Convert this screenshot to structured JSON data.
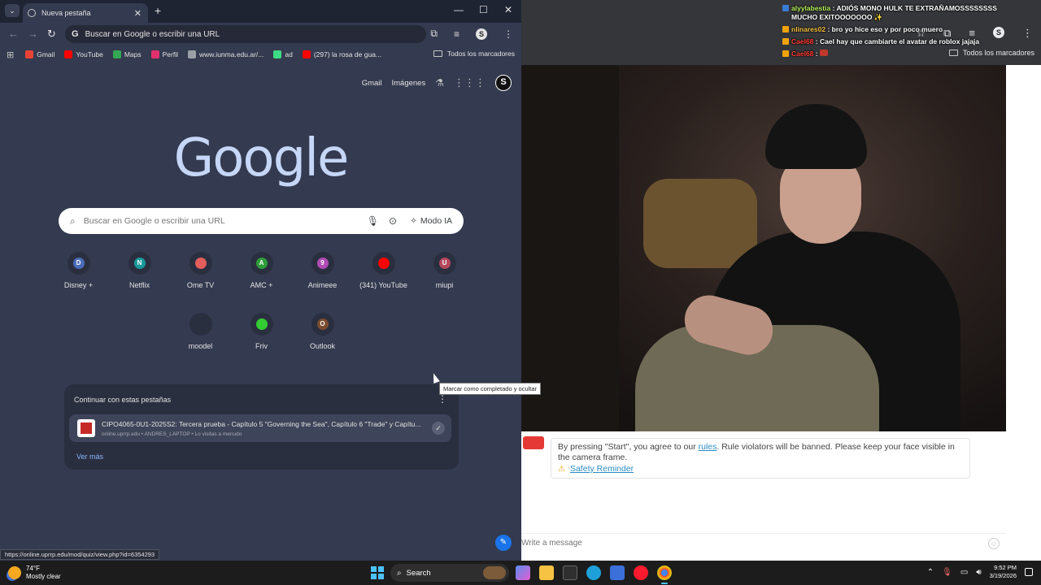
{
  "right_window": {
    "all_bookmarks": "Todos los marcadores",
    "chat": [
      {
        "user": "alyylabestia",
        "sep": ":",
        "text": "ADIÓS MONO HULK TE EXTRAÑAMOSSSSSSSS MUCHO EXITOOOOOOO ✨",
        "user_color": "green"
      },
      {
        "user": "nlinares02",
        "sep": ":",
        "text": "bro yo hice eso y por poco muero",
        "user_color": "yellow"
      },
      {
        "user": "Cael68",
        "sep": ":",
        "text": "Cael hay que cambiarte el avatar de roblox jajaja",
        "user_color": "red"
      },
      {
        "user": "Cael68",
        "sep": ":",
        "text": "",
        "user_color": "red"
      }
    ],
    "notice": {
      "before_link": "By pressing \"Start\", you agree to our ",
      "link": "rules",
      "after_link": ". Rule violators will be banned. Please keep your face visible in the camera frame.",
      "safety_link": "Safety Reminder"
    },
    "message_placeholder": "Write a message"
  },
  "chrome": {
    "tab_title": "Nueva pestaña",
    "omnibox_text": "Buscar en Google o escribir una URL",
    "bookmarks": [
      {
        "label": "Gmail",
        "color": "#ea4335"
      },
      {
        "label": "YouTube",
        "color": "#ff0000"
      },
      {
        "label": "Maps",
        "color": "#34a853"
      },
      {
        "label": "Perfil",
        "color": "#e1306c"
      },
      {
        "label": "www.iunma.edu.ar/...",
        "color": "#9aa0a6"
      },
      {
        "label": "ad",
        "color": "#3ddc84"
      },
      {
        "label": "(297) la rosa de gua...",
        "color": "#ff0000"
      }
    ],
    "all_bookmarks": "Todos los marcadores",
    "profile_initial": "S"
  },
  "ntp": {
    "gmail_link": "Gmail",
    "images_link": "Imágenes",
    "logo": "Google",
    "search_placeholder": "Buscar en Google o escribir una URL",
    "ai_mode": "Modo IA",
    "shortcuts": [
      {
        "label": "Disney +",
        "letter": "D",
        "color": "#4b6cb7"
      },
      {
        "label": "Netflix",
        "letter": "N",
        "color": "#1a9a9a"
      },
      {
        "label": "Ome TV",
        "letter": "",
        "color": "#e35d5b"
      },
      {
        "label": "AMC +",
        "letter": "A",
        "color": "#2e9d3a"
      },
      {
        "label": "Animeee",
        "letter": "9",
        "color": "#b04bb4"
      },
      {
        "label": "(341) YouTube",
        "letter": "",
        "color": "#ff0000"
      },
      {
        "label": "miupi",
        "letter": "U",
        "color": "#b5485d"
      },
      {
        "label": "moodel",
        "letter": "",
        "color": "#2a2f40"
      },
      {
        "label": "Friv",
        "letter": "",
        "color": "#33cc33"
      },
      {
        "label": "Outlook",
        "letter": "O",
        "color": "#7a4b2e"
      }
    ],
    "continue": {
      "title": "Continuar con estas pestañas",
      "item_title": "CIPO4065-0U1-2025S2: Tercera prueba - Capítulo 5 \"Governing the Sea\", Capítulo 6 \"Trade\" y Capítu...",
      "item_sub": "online.uprrp.edu • ANDRES_LAPTOP • Lo visitas a menudo",
      "see_more": "Ver más"
    },
    "tooltip": "Marcar como completado y ocultar"
  },
  "status_url": "https://online.uprrp.edu/mod/quiz/view.php?id=6354293",
  "taskbar": {
    "temp": "74°F",
    "condition": "Mostly clear",
    "search_label": "Search",
    "time": "9:52 PM",
    "date": "3/19/2026"
  }
}
